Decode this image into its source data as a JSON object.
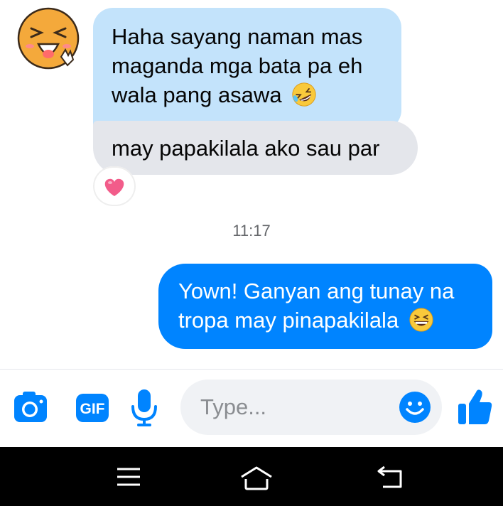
{
  "conversation": {
    "incoming": [
      {
        "text": "Haha sayang naman mas maganda mga bata pa eh wala pang asawa",
        "emoji": "rolling-laughing-emoji"
      },
      {
        "text": "may papakilala ako sau par"
      }
    ],
    "reaction": "pink-heart-emoji",
    "timestamp": "11:17",
    "outgoing": [
      {
        "text": "Yown! Ganyan ang tunay na tropa may pinapakilala",
        "emoji": "grinning-squint-emoji"
      }
    ]
  },
  "composer": {
    "placeholder": "Type...",
    "gif_label": "GIF",
    "icons": [
      "camera-icon",
      "gif-icon",
      "microphone-icon",
      "emoji-icon",
      "thumbs-up-icon"
    ]
  },
  "navbar": {
    "icons": [
      "menu-icon",
      "home-icon",
      "back-icon"
    ]
  },
  "colors": {
    "incoming_highlight": "#c3e3fb",
    "incoming": "#e4e6eb",
    "outgoing": "#0084ff",
    "accent": "#0084ff"
  }
}
